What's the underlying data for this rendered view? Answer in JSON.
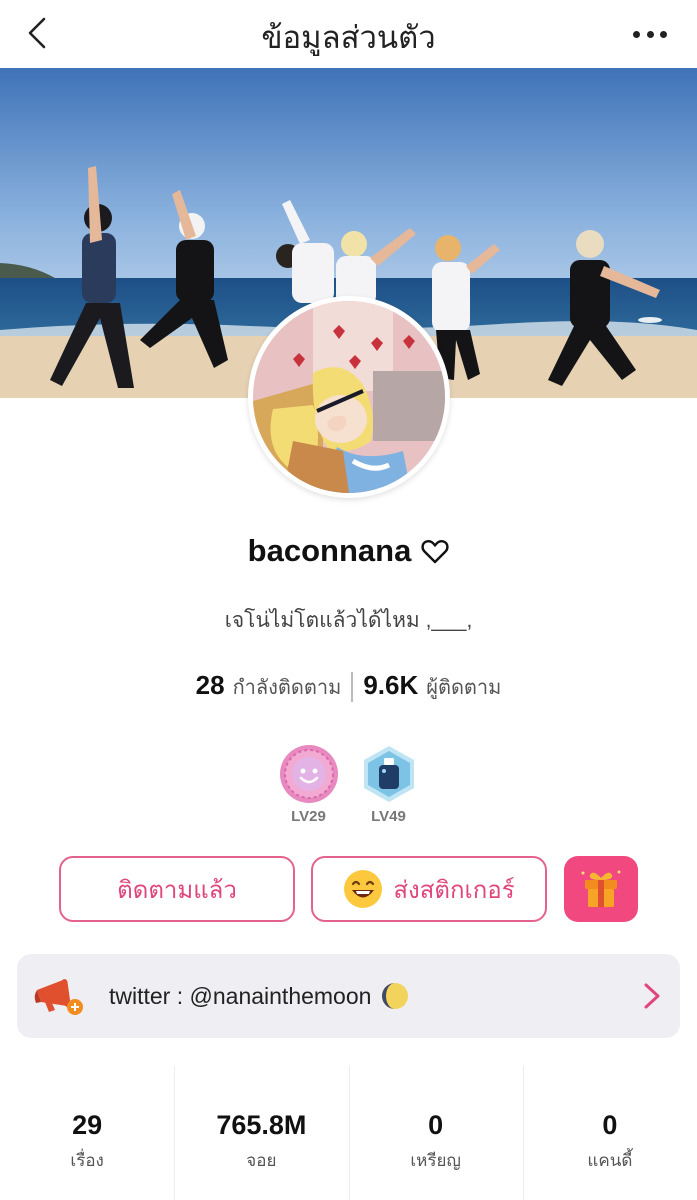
{
  "header": {
    "title": "ข้อมูลส่วนตัว",
    "back_icon": "chevron-left-icon",
    "more_icon": "more-horizontal-icon"
  },
  "profile": {
    "username": "baconnana",
    "username_icon": "heart-outline-icon",
    "bio": "เจโน่ไม่โตแล้วได้ไหม ,___,",
    "following_count": "28",
    "following_label": "กำลังติดตาม",
    "followers_count": "9.6K",
    "followers_label": "ผู้ติดตาม"
  },
  "badges": [
    {
      "icon": "smiley-medal-icon",
      "level": "LV29"
    },
    {
      "icon": "bottle-medal-icon",
      "level": "LV49"
    }
  ],
  "actions": {
    "follow_label": "ติดตามแล้ว",
    "sticker_label": "ส่งสติกเกอร์",
    "sticker_icon": "grinning-emoji-icon",
    "gift_icon": "gift-box-icon"
  },
  "link": {
    "icon": "megaphone-icon",
    "text": "twitter : @nanainthemoon",
    "trailing_icon": "crescent-moon-icon"
  },
  "bottom_stats": [
    {
      "value": "29",
      "label": "เรื่อง"
    },
    {
      "value": "765.8M",
      "label": "จอย"
    },
    {
      "value": "0",
      "label": "เหรียญ"
    },
    {
      "value": "0",
      "label": "แคนดี้"
    }
  ],
  "colors": {
    "accent_pink": "#e0457b",
    "gift_bg": "#f0487f",
    "card_bg": "#efeef2"
  }
}
